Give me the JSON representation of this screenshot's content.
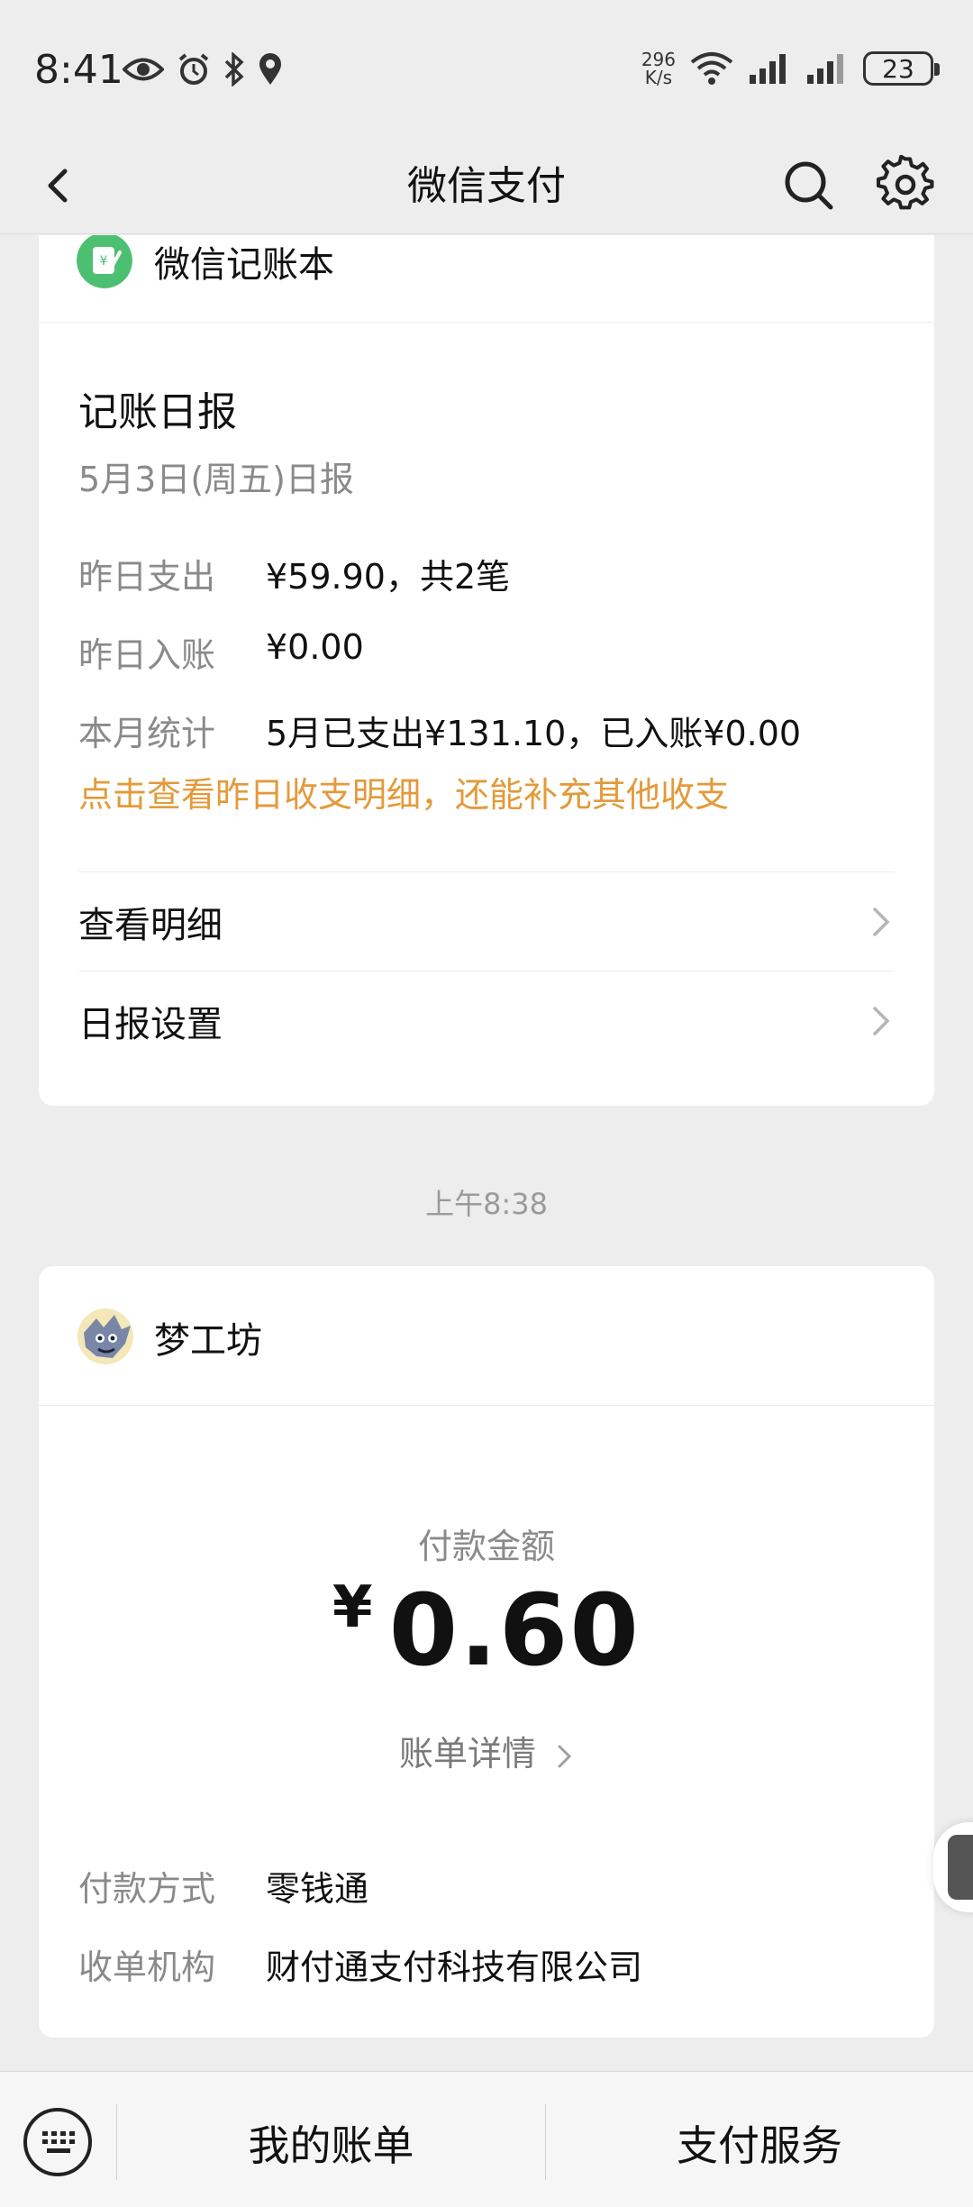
{
  "status_bar": {
    "time": "8:41",
    "net_speed_value": "296",
    "net_speed_unit": "K/s",
    "battery": "23",
    "icons": [
      "eye-icon",
      "alarm-icon",
      "bluetooth-icon",
      "location-icon",
      "wifi-icon",
      "signal-icon",
      "signal-icon"
    ]
  },
  "nav": {
    "title": "微信支付",
    "back_icon": "chevron-left-icon",
    "search_icon": "search-icon",
    "settings_icon": "gear-icon"
  },
  "ledger_card": {
    "app_name": "微信记账本",
    "report_title": "记账日报",
    "report_subtitle": "5月3日(周五)日报",
    "rows": [
      {
        "label": "昨日支出",
        "value": "¥59.90，共2笔"
      },
      {
        "label": "昨日入账",
        "value": "¥0.00"
      },
      {
        "label": "本月统计",
        "value": "5月已支出¥131.10，已入账¥0.00"
      }
    ],
    "hint": "点击查看昨日收支明细，还能补充其他收支",
    "links": [
      {
        "label": "查看明细"
      },
      {
        "label": "日报设置"
      }
    ]
  },
  "timestamp": "上午8:38",
  "payment_card": {
    "merchant": "梦工坊",
    "pay_label": "付款金额",
    "currency": "¥",
    "amount": "0.60",
    "bill_detail": "账单详情",
    "rows": [
      {
        "label": "付款方式",
        "value": "零钱通"
      },
      {
        "label": "收单机构",
        "value": "财付通支付科技有限公司"
      }
    ]
  },
  "bottom_bar": {
    "keyboard_icon": "keyboard-icon",
    "my_bills": "我的账单",
    "pay_services": "支付服务"
  },
  "colors": {
    "background": "#ededed",
    "card": "#ffffff",
    "hint_orange": "#e39a3a",
    "ledger_green": "#4cc070",
    "muted_text": "#8a8a8a"
  }
}
